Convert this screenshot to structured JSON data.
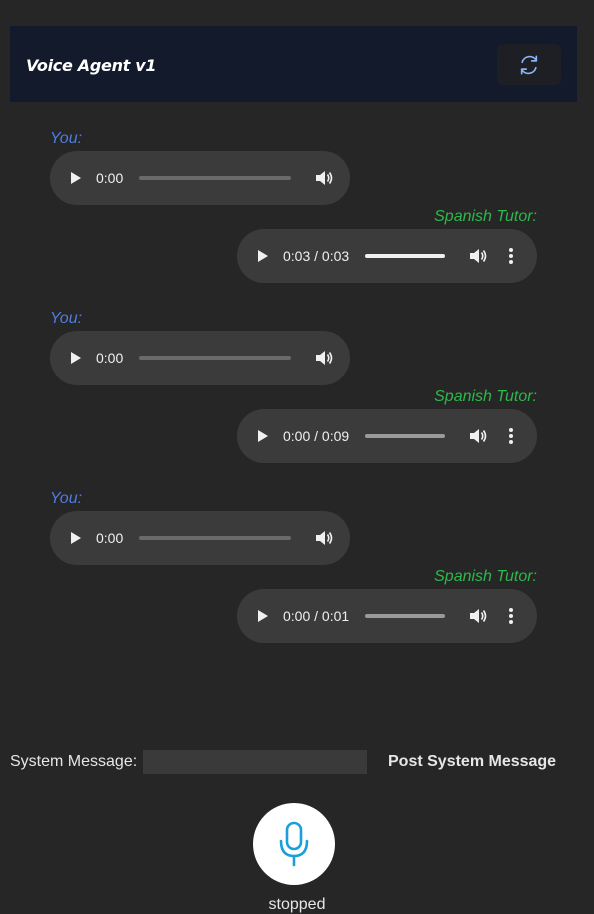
{
  "header": {
    "title": "Voice Agent v1",
    "refresh_icon": "refresh-icon"
  },
  "messages": [
    {
      "role": "user",
      "label": "You:",
      "time": "0:00"
    },
    {
      "role": "tutor",
      "label": "Spanish Tutor:",
      "time": "0:03 / 0:03",
      "progress": 1.0
    },
    {
      "role": "user",
      "label": "You:",
      "time": "0:00"
    },
    {
      "role": "tutor",
      "label": "Spanish Tutor:",
      "time": "0:00 / 0:09",
      "progress": 0.0
    },
    {
      "role": "user",
      "label": "You:",
      "time": "0:00"
    },
    {
      "role": "tutor",
      "label": "Spanish Tutor:",
      "time": "0:00 / 0:01",
      "progress": 0.0
    }
  ],
  "system": {
    "label": "System Message:",
    "input_value": "",
    "post_label": "Post System Message"
  },
  "mic": {
    "icon": "microphone-icon",
    "status": "stopped"
  },
  "colors": {
    "user_label": "#4f7de0",
    "tutor_label": "#2db84c",
    "mic_icon": "#1aa0d8"
  }
}
